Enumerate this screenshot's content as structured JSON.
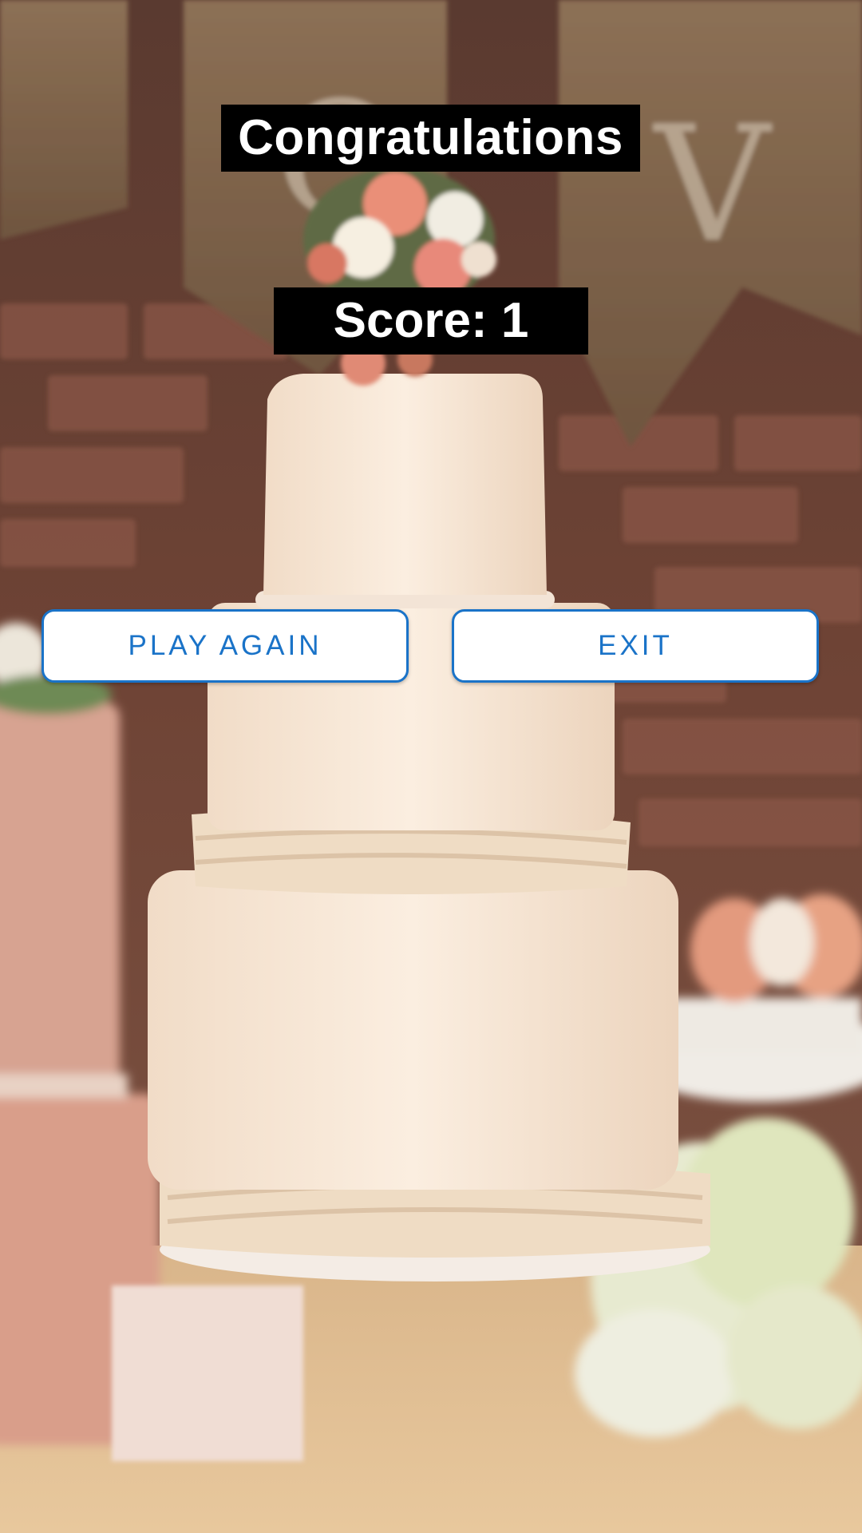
{
  "result": {
    "title": "Congratulations",
    "score_text": "Score: 1"
  },
  "actions": {
    "play_again_label": "PLAY AGAIN",
    "exit_label": "EXIT"
  },
  "colors": {
    "button_accent": "#1a73c8",
    "label_background": "#000000",
    "label_text": "#ffffff"
  },
  "background": {
    "description_icon": "wedding-cake-photo"
  }
}
